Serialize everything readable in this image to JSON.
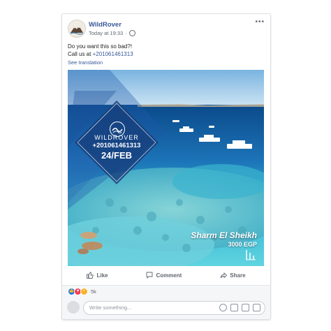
{
  "post": {
    "page_name": "WildRover",
    "timestamp": "Today at 19:33",
    "privacy_icon": "globe-icon",
    "more_icon": "ellipsis-icon",
    "message_line1": "Do you want this so bad?!",
    "message_line2_prefix": "Call us at ",
    "message_phone": "+201061461313",
    "see_translation": "See translation"
  },
  "image": {
    "badge_brand": "WILDROVER",
    "badge_phone": "+201061461313",
    "badge_date": "24/FEB",
    "place_name": "Sharm El Sheikh",
    "place_price": "3000 EGP"
  },
  "actions": {
    "like_label": "Like",
    "comment_label": "Comment",
    "share_label": "Share"
  },
  "reactions": {
    "types": [
      "like",
      "love",
      "wow"
    ],
    "count": "5k"
  },
  "comment": {
    "placeholder": "Write something..."
  },
  "colors": {
    "link": "#385898",
    "text": "#1c1e21",
    "muted": "#606770",
    "sea_deep": "#0d4f8c",
    "sea_shallow": "#44c5d8"
  }
}
